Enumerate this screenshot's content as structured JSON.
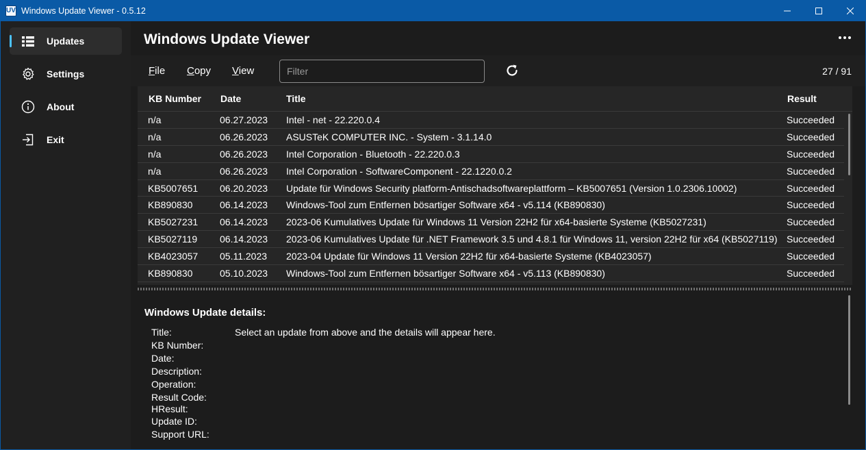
{
  "window": {
    "app_icon": "UV",
    "title": "Windows Update Viewer - 0.5.12"
  },
  "sidebar": {
    "items": [
      {
        "label": "Updates",
        "icon": "list-icon",
        "active": true
      },
      {
        "label": "Settings",
        "icon": "gear-icon"
      },
      {
        "label": "About",
        "icon": "info-icon"
      },
      {
        "label": "Exit",
        "icon": "exit-icon"
      }
    ]
  },
  "main": {
    "title": "Windows Update Viewer"
  },
  "toolbar": {
    "file_accel": "F",
    "file_rest": "ile",
    "copy_accel": "C",
    "copy_rest": "opy",
    "view_accel": "V",
    "view_rest": "iew",
    "filter_placeholder": "Filter",
    "counter": "27 / 91"
  },
  "table": {
    "columns": [
      "KB Number",
      "Date",
      "Title",
      "Result"
    ],
    "rows": [
      {
        "kb": "n/a",
        "date": "06.27.2023",
        "title": "Intel - net - 22.220.0.4",
        "result": "Succeeded"
      },
      {
        "kb": "n/a",
        "date": "06.26.2023",
        "title": "ASUSTeK COMPUTER INC. - System - 3.1.14.0",
        "result": "Succeeded"
      },
      {
        "kb": "n/a",
        "date": "06.26.2023",
        "title": "Intel Corporation - Bluetooth - 22.220.0.3",
        "result": "Succeeded"
      },
      {
        "kb": "n/a",
        "date": "06.26.2023",
        "title": "Intel Corporation - SoftwareComponent - 22.1220.0.2",
        "result": "Succeeded"
      },
      {
        "kb": "KB5007651",
        "date": "06.20.2023",
        "title": "Update für Windows Security platform-Antischadsoftwareplattform – KB5007651 (Version 1.0.2306.10002)",
        "result": "Succeeded"
      },
      {
        "kb": "KB890830",
        "date": "06.14.2023",
        "title": "Windows-Tool zum Entfernen bösartiger Software x64 - v5.114 (KB890830)",
        "result": "Succeeded"
      },
      {
        "kb": "KB5027231",
        "date": "06.14.2023",
        "title": "2023-06 Kumulatives Update für Windows 11 Version 22H2 für x64-basierte Systeme (KB5027231)",
        "result": "Succeeded"
      },
      {
        "kb": "KB5027119",
        "date": "06.14.2023",
        "title": "2023-06 Kumulatives Update für .NET Framework 3.5 und 4.8.1 für Windows 11, version 22H2 für x64 (KB5027119)",
        "result": "Succeeded"
      },
      {
        "kb": "KB4023057",
        "date": "05.11.2023",
        "title": "2023-04 Update für Windows 11 Version 22H2 für x64-basierte Systeme (KB4023057)",
        "result": "Succeeded"
      },
      {
        "kb": "KB890830",
        "date": "05.10.2023",
        "title": "Windows-Tool zum Entfernen bösartiger Software x64 - v5.113 (KB890830)",
        "result": "Succeeded"
      }
    ]
  },
  "details": {
    "title": "Windows Update details:",
    "labels": [
      "Title:",
      "KB Number:",
      "Date:",
      "Description:",
      "Operation:",
      "Result Code:",
      "HResult:",
      "Update ID:",
      "Support URL:"
    ],
    "placeholder": "Select an update from above and the details will appear here."
  },
  "colors": {
    "titlebar": "#0a5aa6",
    "accent": "#4cc2ff",
    "background": "#1c1c1c",
    "sidebar": "#202020",
    "table": "#262626"
  }
}
